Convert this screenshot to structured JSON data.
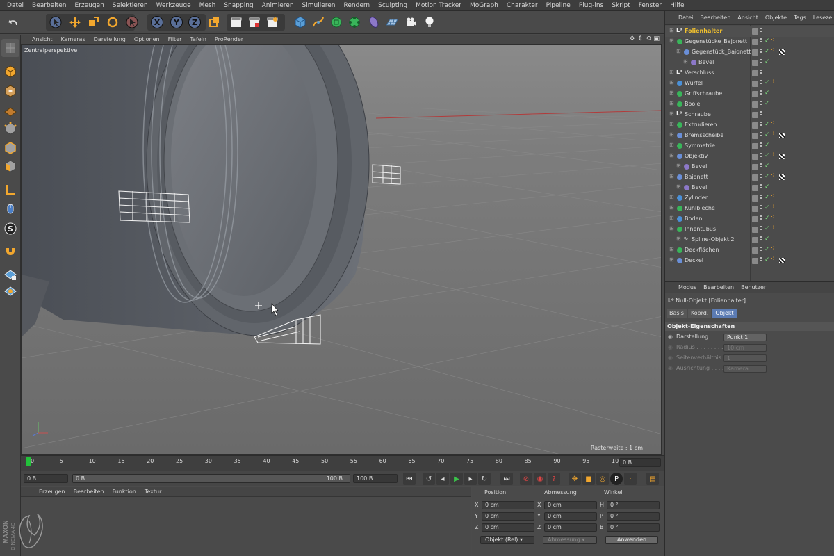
{
  "menubar": [
    "Datei",
    "Bearbeiten",
    "Erzeugen",
    "Selektieren",
    "Werkzeuge",
    "Mesh",
    "Snapping",
    "Animieren",
    "Simulieren",
    "Rendern",
    "Sculpting",
    "Motion Tracker",
    "MoGraph",
    "Charakter",
    "Pipeline",
    "Plug-ins",
    "Skript",
    "Fenster",
    "Hilfe"
  ],
  "toolbar_icons": [
    "undo-icon",
    "select-arrow-icon",
    "move-icon",
    "scale-icon",
    "rotate-icon",
    "recent-tool-icon",
    "x-axis-icon",
    "y-axis-icon",
    "z-axis-icon",
    "coordinate-system-icon",
    "render-view-icon",
    "render-picture-queue-icon",
    "render-settings-icon",
    "cube-primitive-icon",
    "pen-spline-icon",
    "subdivision-icon",
    "array-icon",
    "deformer-icon",
    "floor-icon",
    "camera-icon",
    "light-icon"
  ],
  "viewport": {
    "menus": [
      "Ansicht",
      "Kameras",
      "Darstellung",
      "Optionen",
      "Filter",
      "Tafeln",
      "ProRender"
    ],
    "name": "Zentralperspektive",
    "raster": "Rasterweite : 1 cm"
  },
  "timeline": {
    "ticks": [
      "0",
      "5",
      "10",
      "15",
      "20",
      "25",
      "30",
      "35",
      "40",
      "45",
      "50",
      "55",
      "60",
      "65",
      "70",
      "75",
      "80",
      "85",
      "90",
      "95",
      "10("
    ],
    "current_frame": "0 B",
    "start": "0 B",
    "range_start": "0 B",
    "range_end": "100 B",
    "end": "100 B"
  },
  "material_manager": {
    "menus": [
      "Erzeugen",
      "Bearbeiten",
      "Funktion",
      "Textur"
    ]
  },
  "logo": {
    "brand": "MAXON",
    "product": "CINEMA 4D"
  },
  "coordinates": {
    "headers": [
      "Position",
      "Abmessung",
      "Winkel"
    ],
    "rows": [
      {
        "axis": "X",
        "pos": "0 cm",
        "daxis": "X",
        "dim": "0 cm",
        "aaxis": "H",
        "ang": "0 °"
      },
      {
        "axis": "Y",
        "pos": "0 cm",
        "daxis": "Y",
        "dim": "0 cm",
        "aaxis": "P",
        "ang": "0 °"
      },
      {
        "axis": "Z",
        "pos": "0 cm",
        "daxis": "Z",
        "dim": "0 cm",
        "aaxis": "B",
        "ang": "0 °"
      }
    ],
    "mode": "Objekt (Rel)",
    "size_mode": "Abmessung",
    "apply": "Anwenden"
  },
  "object_manager": {
    "menus": [
      "Datei",
      "Bearbeiten",
      "Ansicht",
      "Objekte",
      "Tags",
      "Lesezeic"
    ],
    "objects": [
      {
        "name": "Folienhalter",
        "indent": 0,
        "type": "null",
        "selected": true,
        "tags": []
      },
      {
        "name": "Gegenstücke_Bajonett",
        "indent": 0,
        "type": "green",
        "tags": [
          "phong"
        ]
      },
      {
        "name": "Gegenstück_Bajonett",
        "indent": 1,
        "type": "blue-tri",
        "tags": [
          "phong",
          "checker"
        ]
      },
      {
        "name": "Bevel",
        "indent": 2,
        "type": "purple",
        "tags": []
      },
      {
        "name": "Verschluss",
        "indent": 0,
        "type": "null",
        "tags": []
      },
      {
        "name": "Würfel",
        "indent": 0,
        "type": "blue",
        "tags": [
          "phong"
        ]
      },
      {
        "name": "Griffschraube",
        "indent": 0,
        "type": "green",
        "tags": []
      },
      {
        "name": "Boole",
        "indent": 0,
        "type": "green",
        "tags": []
      },
      {
        "name": "Schraube",
        "indent": 0,
        "type": "null",
        "tags": []
      },
      {
        "name": "Extrudieren",
        "indent": 0,
        "type": "green",
        "tags": [
          "phong"
        ]
      },
      {
        "name": "Bremsscheibe",
        "indent": 0,
        "type": "blue-tri",
        "tags": [
          "phong",
          "checker"
        ]
      },
      {
        "name": "Symmetrie",
        "indent": 0,
        "type": "green",
        "tags": []
      },
      {
        "name": "Objektiv",
        "indent": 0,
        "type": "blue-tri",
        "tags": [
          "phong",
          "checker"
        ]
      },
      {
        "name": "Bevel",
        "indent": 1,
        "type": "purple",
        "tags": []
      },
      {
        "name": "Bajonett",
        "indent": 0,
        "type": "blue-tri",
        "tags": [
          "phong",
          "checker"
        ]
      },
      {
        "name": "Bevel",
        "indent": 1,
        "type": "purple",
        "tags": []
      },
      {
        "name": "Zylinder",
        "indent": 0,
        "type": "blue",
        "tags": [
          "phong"
        ]
      },
      {
        "name": "Kühlbleche",
        "indent": 0,
        "type": "green",
        "tags": [
          "phong"
        ]
      },
      {
        "name": "Boden",
        "indent": 0,
        "type": "blue",
        "tags": [
          "phong"
        ]
      },
      {
        "name": "Innentubus",
        "indent": 0,
        "type": "green",
        "tags": [
          "phong"
        ]
      },
      {
        "name": "Spline-Objekt.2",
        "indent": 1,
        "type": "spline",
        "tags": []
      },
      {
        "name": "Deckflächen",
        "indent": 0,
        "type": "green",
        "tags": [
          "phong"
        ]
      },
      {
        "name": "Deckel",
        "indent": 0,
        "type": "blue-tri",
        "tags": [
          "phong",
          "checker"
        ]
      }
    ]
  },
  "attribute_manager": {
    "menus": [
      "Modus",
      "Bearbeiten",
      "Benutzer"
    ],
    "object_title": "Null-Objekt [Folienhalter]",
    "tabs": [
      "Basis",
      "Koord.",
      "Objekt"
    ],
    "active_tab": "Objekt",
    "section": "Objekt-Eigenschaften",
    "props": [
      {
        "label": "Darstellung . . . . .",
        "value": "Punkt 1",
        "enabled": true
      },
      {
        "label": "Radius . . . . . . . .",
        "value": "10 cm",
        "enabled": false
      },
      {
        "label": "Seitenverhältnis .",
        "value": "1",
        "enabled": false
      },
      {
        "label": "Ausrichtung . . . .",
        "value": "Kamera",
        "enabled": false
      }
    ]
  },
  "colors": {
    "accent": "#5b7bb3",
    "selected_object": "#f2c12e",
    "playhead": "#22c23a"
  }
}
